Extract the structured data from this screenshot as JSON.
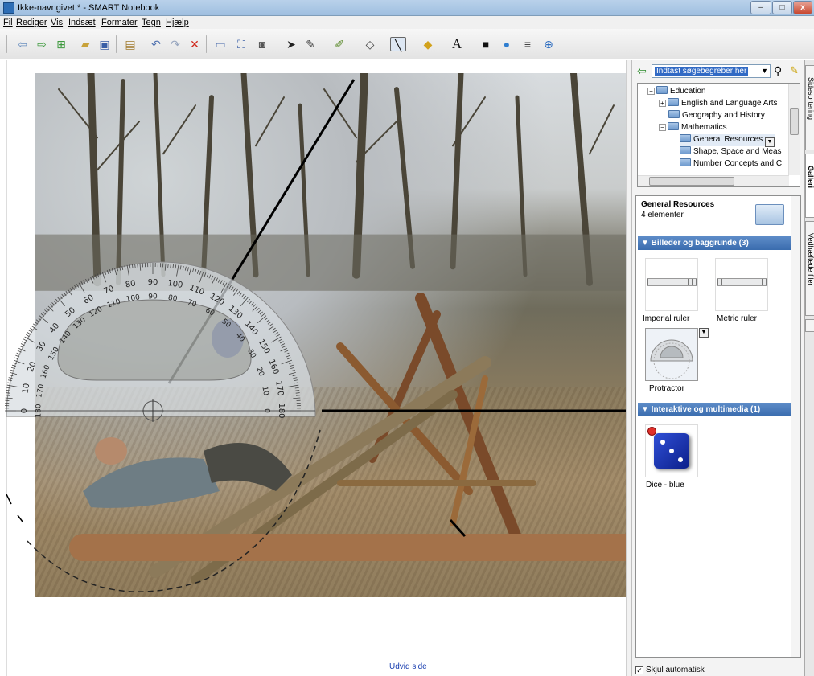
{
  "window": {
    "title": "Ikke-navngivet * - SMART Notebook",
    "minimize": "–",
    "maximize": "□",
    "close": "x"
  },
  "menu": [
    {
      "label": "Fil"
    },
    {
      "label": "Rediger"
    },
    {
      "label": "Vis"
    },
    {
      "label": "Indsæt"
    },
    {
      "label": "Formater"
    },
    {
      "label": "Tegn"
    },
    {
      "label": "Hjælp"
    }
  ],
  "toolbar": {
    "icons": [
      "previous-page-icon",
      "next-page-icon",
      "add-page-icon",
      "open-icon",
      "save-icon",
      "paste-icon",
      "undo-icon",
      "redo-icon",
      "delete-icon",
      "screen-shade-icon",
      "full-screen-icon",
      "capture-icon",
      "select-icon",
      "pen-icon",
      "creative-pen-icon",
      "eraser-icon",
      "line-icon",
      "shape-icon",
      "text-icon",
      "fill-icon",
      "properties-icon",
      "toolbar-settings-icon",
      "help-icon"
    ]
  },
  "canvas": {
    "expand_link": "Udvid side",
    "protractor_labels_outer": [
      "0",
      "10",
      "20",
      "30",
      "40",
      "50",
      "60",
      "70",
      "80",
      "90",
      "100",
      "110",
      "120",
      "130",
      "140",
      "150",
      "160",
      "170",
      "180"
    ],
    "protractor_labels_inner": [
      "180",
      "170",
      "160",
      "150",
      "140",
      "130",
      "120",
      "110",
      "100",
      "90",
      "80",
      "70",
      "60",
      "50",
      "40",
      "30",
      "20",
      "10",
      "0"
    ]
  },
  "panel": {
    "search_placeholder": "Indtast søgebegreber her",
    "tree": [
      {
        "label": "Education",
        "level": 0,
        "expander": "−"
      },
      {
        "label": "English and Language Arts",
        "level": 1,
        "expander": "+"
      },
      {
        "label": "Geography and History",
        "level": 1,
        "expander": ""
      },
      {
        "label": "Mathematics",
        "level": 1,
        "expander": "−"
      },
      {
        "label": "General Resources",
        "level": 2,
        "expander": ""
      },
      {
        "label": "Shape, Space and Meas",
        "level": 2,
        "expander": ""
      },
      {
        "label": "Number Concepts and C",
        "level": 2,
        "expander": ""
      }
    ],
    "gallery": {
      "title": "General Resources",
      "count": "4 elementer",
      "sections": [
        {
          "label": "▼ Billeder og baggrunde (3)"
        },
        {
          "label": "▼ Interaktive og multimedia (1)"
        }
      ],
      "items": [
        {
          "label": "Imperial ruler"
        },
        {
          "label": "Metric ruler"
        },
        {
          "label": "Protractor"
        },
        {
          "label": "Dice - blue"
        }
      ]
    },
    "autohide": "Skjul automatisk"
  },
  "sidetabs": [
    {
      "label": "Sidesortering"
    },
    {
      "label": "Galleri"
    },
    {
      "label": "Vedhæftede filer"
    }
  ],
  "colors": {
    "section_header": "#3a6cae",
    "search_highlight": "#316ac5",
    "link": "#1a3fb0"
  }
}
